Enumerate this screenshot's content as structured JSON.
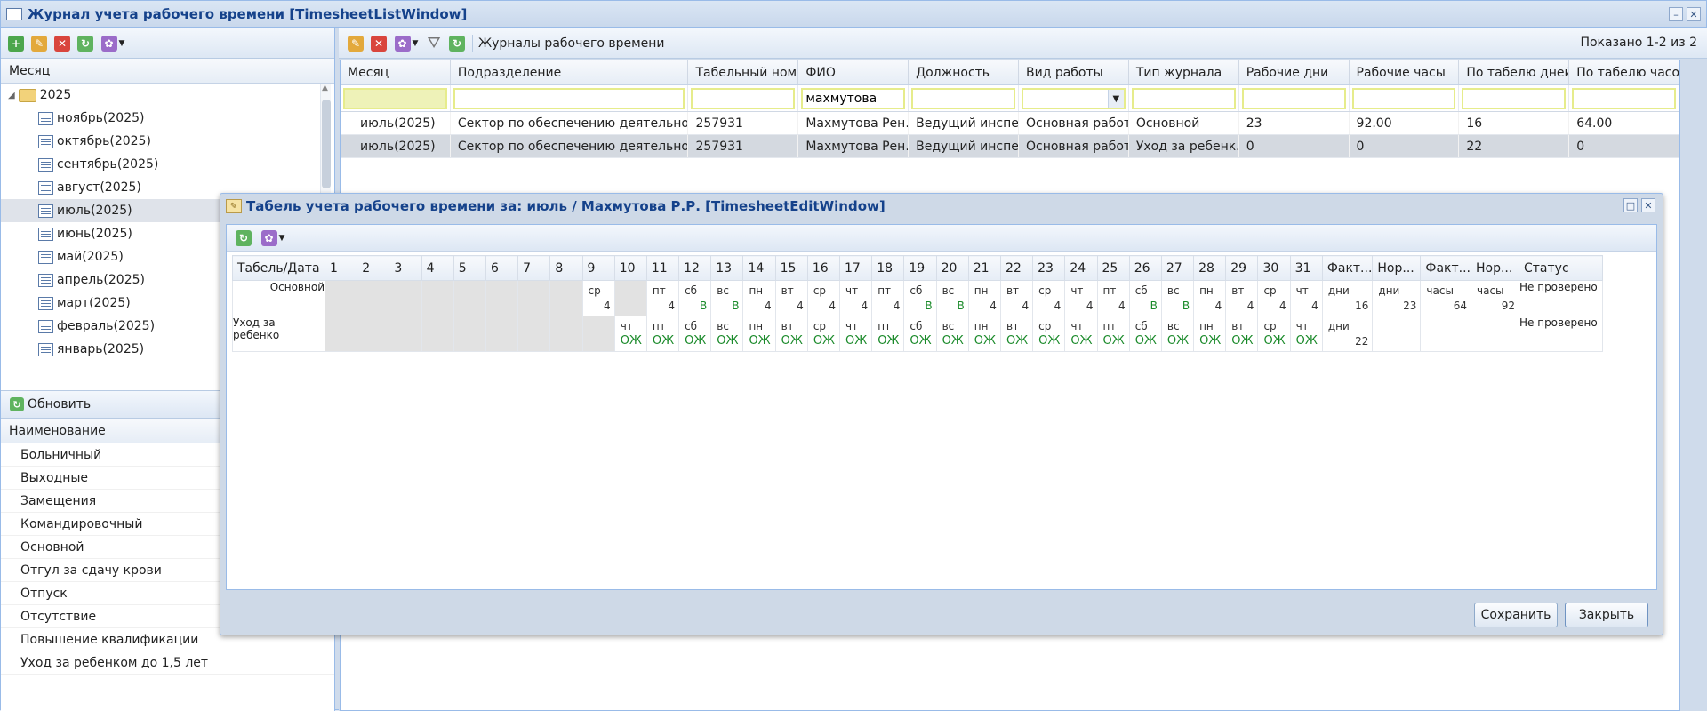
{
  "window": {
    "title": "Журнал учета рабочего времени [TimesheetListWindow]"
  },
  "left": {
    "month_header": "Месяц",
    "year": "2025",
    "months": [
      "ноябрь(2025)",
      "октябрь(2025)",
      "сентябрь(2025)",
      "август(2025)",
      "июль(2025)",
      "июнь(2025)",
      "май(2025)",
      "апрель(2025)",
      "март(2025)",
      "февраль(2025)",
      "январь(2025)"
    ],
    "selected_month_index": 4,
    "refresh_label": "Обновить",
    "name_header": "Наименование",
    "names": [
      "Больничный",
      "Выходные",
      "Замещения",
      "Командировочный",
      "Основной",
      "Отгул за сдачу крови",
      "Отпуск",
      "Отсутствие",
      "Повышение квалификации",
      "Уход за ребенком до 1,5 лет"
    ]
  },
  "right": {
    "toolbar_label": "Журналы рабочего времени",
    "shown": "Показано 1-2 из 2",
    "columns": [
      "Месяц",
      "Подразделение",
      "Табельный ном...",
      "ФИО",
      "Должность",
      "Вид работы",
      "Тип журнала",
      "Рабочие дни",
      "Рабочие часы",
      "По табелю дней",
      "По табелю часов"
    ],
    "filter_fio": "махмутова",
    "rows": [
      [
        "июль(2025)",
        "Сектор по обеспечению деятельности",
        "257931",
        "Махмутова Рен...",
        "Ведущий инспе...",
        "Основная работа",
        "Основной",
        "23",
        "92.00",
        "16",
        "64.00"
      ],
      [
        "июль(2025)",
        "Сектор по обеспечению деятельности",
        "257931",
        "Махмутова Рен...",
        "Ведущий инспе...",
        "Основная работа",
        "Уход за ребенк...",
        "0",
        "0",
        "22",
        "0"
      ]
    ]
  },
  "modal": {
    "title": "Табель учета рабочего времени за: июль / Махмутова Р.Р. [TimesheetEditWindow]",
    "col_first": "Табель/Дата",
    "days": [
      "1",
      "2",
      "3",
      "4",
      "5",
      "6",
      "7",
      "8",
      "9",
      "10",
      "11",
      "12",
      "13",
      "14",
      "15",
      "16",
      "17",
      "18",
      "19",
      "20",
      "21",
      "22",
      "23",
      "24",
      "25",
      "26",
      "27",
      "28",
      "29",
      "30",
      "31"
    ],
    "summary_cols": [
      "Факт...",
      "Нор...",
      "Факт...",
      "Нор...",
      "Статус"
    ],
    "row1": {
      "label": "Основной",
      "days": [
        {
          "off": true
        },
        {
          "off": true
        },
        {
          "off": true
        },
        {
          "off": true
        },
        {
          "off": true
        },
        {
          "off": true
        },
        {
          "off": true
        },
        {
          "off": true
        },
        {
          "dw": "ср",
          "v": "4"
        },
        {
          "off": true
        },
        {
          "dw": "пт",
          "v": "4"
        },
        {
          "dw": "сб",
          "v": "В",
          "g": true
        },
        {
          "dw": "вс",
          "v": "В",
          "g": true
        },
        {
          "dw": "пн",
          "v": "4"
        },
        {
          "dw": "вт",
          "v": "4"
        },
        {
          "dw": "ср",
          "v": "4"
        },
        {
          "dw": "чт",
          "v": "4"
        },
        {
          "dw": "пт",
          "v": "4"
        },
        {
          "dw": "сб",
          "v": "В",
          "g": true
        },
        {
          "dw": "вс",
          "v": "В",
          "g": true
        },
        {
          "dw": "пн",
          "v": "4"
        },
        {
          "dw": "вт",
          "v": "4"
        },
        {
          "dw": "ср",
          "v": "4"
        },
        {
          "dw": "чт",
          "v": "4"
        },
        {
          "dw": "пт",
          "v": "4"
        },
        {
          "dw": "сб",
          "v": "В",
          "g": true
        },
        {
          "dw": "вс",
          "v": "В",
          "g": true
        },
        {
          "dw": "пн",
          "v": "4"
        },
        {
          "dw": "вт",
          "v": "4"
        },
        {
          "dw": "ср",
          "v": "4"
        },
        {
          "dw": "чт",
          "v": "4"
        }
      ],
      "summary": [
        {
          "dw": "дни",
          "v": "16"
        },
        {
          "dw": "дни",
          "v": "23"
        },
        {
          "dw": "часы",
          "v": "64"
        },
        {
          "dw": "часы",
          "v": "92"
        }
      ],
      "status": "Не проверено"
    },
    "row2": {
      "label": "Уход за ребенко",
      "days_off_count": 9,
      "days": [
        {
          "dw": "чт"
        },
        {
          "dw": "пт"
        },
        {
          "dw": "сб"
        },
        {
          "dw": "вс"
        },
        {
          "dw": "пн"
        },
        {
          "dw": "вт"
        },
        {
          "dw": "ср"
        },
        {
          "dw": "чт"
        },
        {
          "dw": "пт"
        },
        {
          "dw": "сб"
        },
        {
          "dw": "вс"
        },
        {
          "dw": "пн"
        },
        {
          "dw": "вт"
        },
        {
          "dw": "ср"
        },
        {
          "dw": "чт"
        },
        {
          "dw": "пт"
        },
        {
          "dw": "сб"
        },
        {
          "dw": "вс"
        },
        {
          "dw": "пн"
        },
        {
          "dw": "вт"
        },
        {
          "dw": "ср"
        },
        {
          "dw": "чт"
        }
      ],
      "code": "ОЖ",
      "summary": [
        {
          "dw": "дни",
          "v": "22"
        }
      ],
      "status": "Не проверено"
    },
    "save_label": "Сохранить",
    "close_label": "Закрыть"
  }
}
